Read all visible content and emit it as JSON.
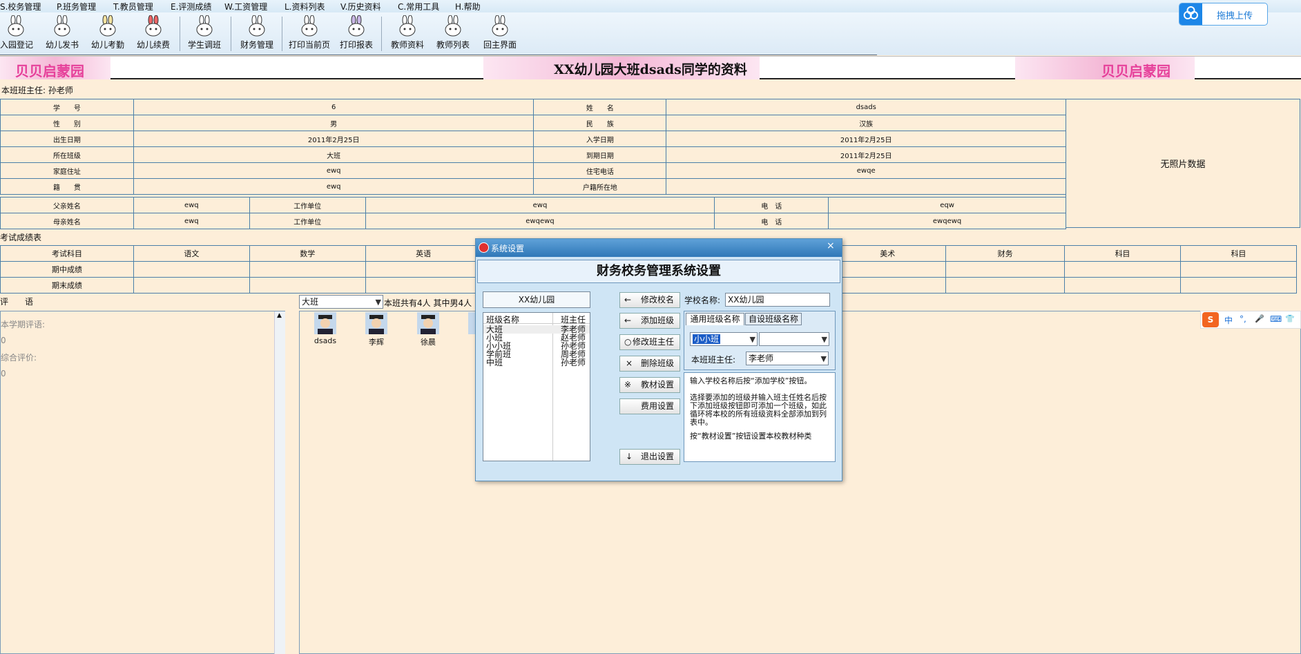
{
  "menu": [
    "S.校务管理",
    "P.班务管理",
    "T.教员管理",
    "E.评测成绩",
    "W.工资管理",
    "L.资料列表",
    "V.历史资料",
    "C.常用工具",
    "H.帮助"
  ],
  "toolbar": [
    "入园登记",
    "幼儿发书",
    "幼儿考勤",
    "幼儿续费",
    "学生调班",
    "财务管理",
    "打印当前页",
    "打印报表",
    "教师资料",
    "教师列表",
    "回主界面"
  ],
  "upload_label": "拖拽上传",
  "banner": {
    "logo": "贝贝启蒙园",
    "title": "XX幼儿园大班dsads同学的资料"
  },
  "teacher_line": "本班班主任:  孙老师",
  "student": {
    "rows": [
      [
        "学　　号",
        "6",
        "姓　　名",
        "dsads"
      ],
      [
        "性　　别",
        "男",
        "民　　族",
        "汉族"
      ],
      [
        "出生日期",
        "2011年2月25日",
        "入学日期",
        "2011年2月25日"
      ],
      [
        "所在班级",
        "大班",
        "到期日期",
        "2011年2月25日"
      ],
      [
        "家庭住址",
        "ewq",
        "住宅电话",
        "ewqe"
      ],
      [
        "籍　　贯",
        "ewq",
        "户籍所在地",
        ""
      ]
    ],
    "photo": "无照片数据"
  },
  "parents": [
    [
      "父亲姓名",
      "ewq",
      "工作单位",
      "ewq",
      "电　话",
      "eqw"
    ],
    [
      "母亲姓名",
      "ewq",
      "工作单位",
      "ewqewq",
      "电　话",
      "ewqewq"
    ]
  ],
  "exam": {
    "title": "考试成绩表",
    "headers": [
      "考试科目",
      "语文",
      "数学",
      "英语",
      "",
      "",
      "",
      "美术",
      "财务",
      "科目",
      "科目"
    ],
    "rows": [
      "期中成绩",
      "期末成绩"
    ]
  },
  "comment": {
    "label": "评　　语",
    "term_label": "本学期评语:",
    "term_value": "0",
    "overall_label": "综合评价:",
    "overall_value": "0"
  },
  "class_select": "大班",
  "class_summary": "本班共有4人  其中男4人",
  "avatars": [
    "dsads",
    "李辉",
    "徐晨",
    ""
  ],
  "ime": {
    "logo": "S",
    "items": [
      "中",
      "°,",
      "🎤",
      "⌨",
      "👕"
    ]
  },
  "dialog": {
    "title": "系统设置",
    "close": "×",
    "heading": "财务校务管理系统设置",
    "school_name_display": "XX幼儿园",
    "list_headers": [
      "班级名称",
      "班主任"
    ],
    "classes": [
      [
        "大班",
        "李老师"
      ],
      [
        "小班",
        "赵老师"
      ],
      [
        "小小班",
        "孙老师"
      ],
      [
        "学前班",
        "周老师"
      ],
      [
        "中班",
        "孙老师"
      ]
    ],
    "buttons": [
      [
        "←",
        "修改校名"
      ],
      [
        "←",
        "添加班级"
      ],
      [
        "○",
        "修改班主任"
      ],
      [
        "×",
        "删除班级"
      ],
      [
        "※",
        "教材设置"
      ],
      [
        "",
        "费用设置"
      ],
      [
        "↓",
        "退出设置"
      ]
    ],
    "school_label": "学校名称:",
    "school_value": "XX幼儿园",
    "tabs": [
      "通用班级名称",
      "自设班级名称"
    ],
    "class_combo": "小小班",
    "teacher_label": "本班班主任:",
    "teacher_value": "李老师",
    "help": [
      "输入学校名称后按“添加学校”按钮。",
      "选择要添加的班级并输入班主任姓名后按下添加班级按钮即可添加一个班级，如此循环将本校的所有班级资料全部添加到列表中。",
      "按“教材设置”按钮设置本校教材种类"
    ]
  }
}
